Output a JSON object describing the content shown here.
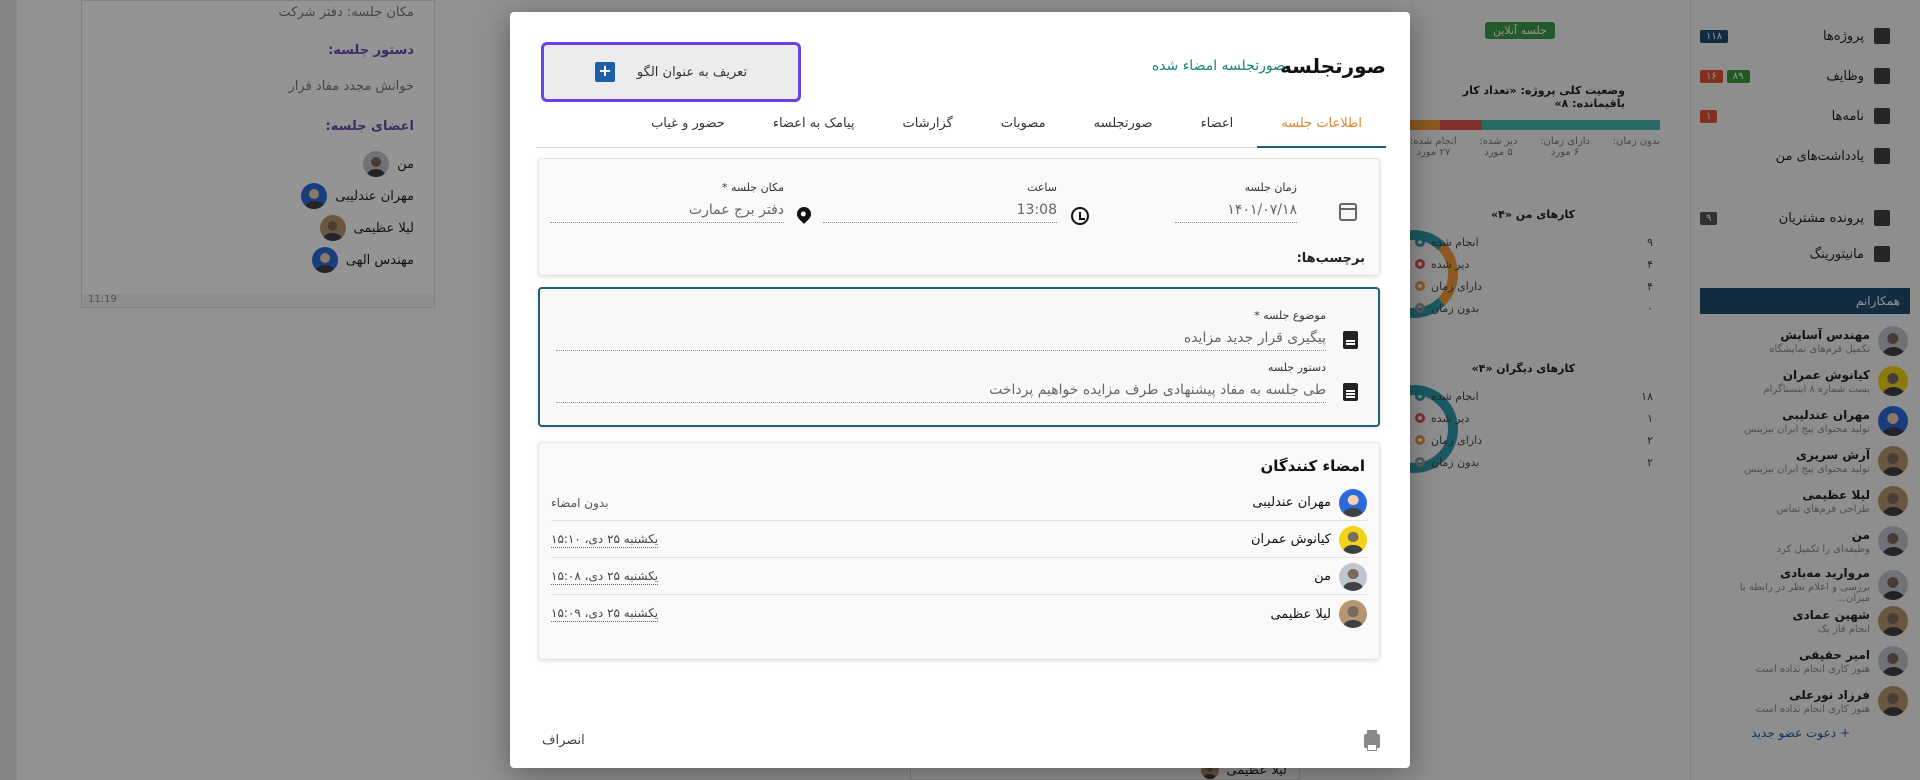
{
  "background": {
    "left_card": {
      "location_line": "مکان جلسه: دفتر شرکت",
      "agenda_heading": "دستور جلسه:",
      "agenda_text": "خوانش مجدد مفاد قرار",
      "members_heading": "اعضای جلسه:",
      "members": [
        "من",
        "مهران عندلیبی",
        "لیلا عظیمی",
        "مهندس الهی"
      ],
      "time": "11:19"
    },
    "bottom_card_member": "لیلا عظیمی",
    "online_chip": "جلسه آنلاین",
    "project_title": "وضعیت کلی پروژه: «تعداد کار باقیمانده: ۸»",
    "project_bar": {
      "done_pct": "۶۷٪",
      "late_pct": "۱۳٪",
      "time_pct": "۱۵٪"
    },
    "project_stats": [
      {
        "label": "انجام شده:",
        "value": "۲۷ مورد"
      },
      {
        "label": "دیر شده:",
        "value": "۵ مورد"
      },
      {
        "label": "دارای زمان:",
        "value": "۶ مورد"
      },
      {
        "label": "بدون زمان:",
        "value": ""
      }
    ],
    "my_tasks": {
      "title": "کارهای من «۴»",
      "rows": [
        {
          "label": "انجام شده",
          "value": "۹",
          "color": "#2d9aa8"
        },
        {
          "label": "دیر شده",
          "value": "۴",
          "color": "#e05555"
        },
        {
          "label": "دارای زمان",
          "value": "۴",
          "color": "#ef9a3c"
        },
        {
          "label": "بدون زمان",
          "value": "۰",
          "color": "#999999"
        }
      ]
    },
    "others_tasks": {
      "title": "کارهای دیگران «۴»",
      "rows": [
        {
          "label": "انجام شده",
          "value": "۱۸",
          "color": "#2d9aa8"
        },
        {
          "label": "دیر شده",
          "value": "۱",
          "color": "#e05555"
        },
        {
          "label": "دارای زمان",
          "value": "۲",
          "color": "#ef9a3c"
        },
        {
          "label": "بدون زمان",
          "value": "۲",
          "color": "#999999"
        }
      ]
    },
    "nav": [
      {
        "label": "پروژه‌ها",
        "badges": [
          {
            "text": "۱۱۸",
            "cls": "b-blue"
          }
        ]
      },
      {
        "label": "وظایف",
        "badges": [
          {
            "text": "۸۹",
            "cls": "b-green"
          },
          {
            "text": "۱۶",
            "cls": "b-red"
          }
        ]
      },
      {
        "label": "نامه‌ها",
        "badges": [
          {
            "text": "۱",
            "cls": "b-red"
          }
        ]
      },
      {
        "label": "یادداشت‌های من",
        "badges": []
      },
      {
        "label": "پرونده مشتریان",
        "badges": [
          {
            "text": "۹",
            "cls": "b-dark"
          }
        ]
      },
      {
        "label": "مانیتورینگ",
        "badges": []
      }
    ],
    "colleagues_heading": "همکارانم",
    "colleagues": [
      {
        "name": "مهندس آسایش",
        "sub": "تکمیل فرم‌های نمایشگاه"
      },
      {
        "name": "کیانوش عمران",
        "sub": "پست شماره ۸ اینستاگرام"
      },
      {
        "name": "مهران عندلیبی",
        "sub": "تولید محتوای پیج ایران بیزینس"
      },
      {
        "name": "آرش سریری",
        "sub": "تولید محتوای پیج ایران بیزینس"
      },
      {
        "name": "لیلا عظیمی",
        "sub": "طراحی فرم‌های تماس"
      },
      {
        "name": "من",
        "sub": "وظیفه‌ای را تکمیل کرد"
      },
      {
        "name": "مروارید مه‌بادی",
        "sub": "بررسی و اعلام نظر در رابطه با میزان..."
      },
      {
        "name": "شهین عمادی",
        "sub": "انجام فاز یک"
      },
      {
        "name": "امیر حقیقی",
        "sub": "هنوز کاری انجام نداده است"
      },
      {
        "name": "فرزاد نورعلی",
        "sub": "هنوز کاری انجام نداده است"
      }
    ],
    "invite_label": "+ دعوت عضو جدید"
  },
  "modal": {
    "title": "صورتجلسه",
    "subtitle": "صورتجلسه امضاء شده",
    "template_button": "تعریف به عنوان الگو",
    "tabs": [
      "اطلاعات جلسه",
      "اعضاء",
      "صورتجلسه",
      "مصوبات",
      "گزارشات",
      "پیامک به اعضاء",
      "حضور و غیاب"
    ],
    "active_tab": 0,
    "date": {
      "label": "زمان جلسه",
      "value": "۱۴۰۱/۰۷/۱۸"
    },
    "time": {
      "label": "ساعت",
      "value": "13:08"
    },
    "location": {
      "label": "مکان جلسه *",
      "value": "دفتر برج عمارت"
    },
    "tags_label": "برچسب‌ها:",
    "subject": {
      "label": "موضوع جلسه *",
      "value": "پیگیری قرار جدید مزایده"
    },
    "agenda": {
      "label": "دستور جلسه",
      "value": "طی جلسه به مفاد پیشنهادی طرف مزایده خواهیم پرداخت"
    },
    "signers_title": "امضاء کنندگان",
    "signers": [
      {
        "name": "مهران عندلیبی",
        "status": "بدون امضاء",
        "signed": false
      },
      {
        "name": "کیانوش عمران",
        "status": "یکشنبه ۲۵ دی، ۱۵:۱۰",
        "signed": true
      },
      {
        "name": "من",
        "status": "یکشنبه ۲۵ دی، ۱۵:۰۸",
        "signed": true
      },
      {
        "name": "لیلا عظیمی",
        "status": "یکشنبه ۲۵ دی، ۱۵:۰۹",
        "signed": true
      }
    ],
    "cancel": "انصراف"
  }
}
